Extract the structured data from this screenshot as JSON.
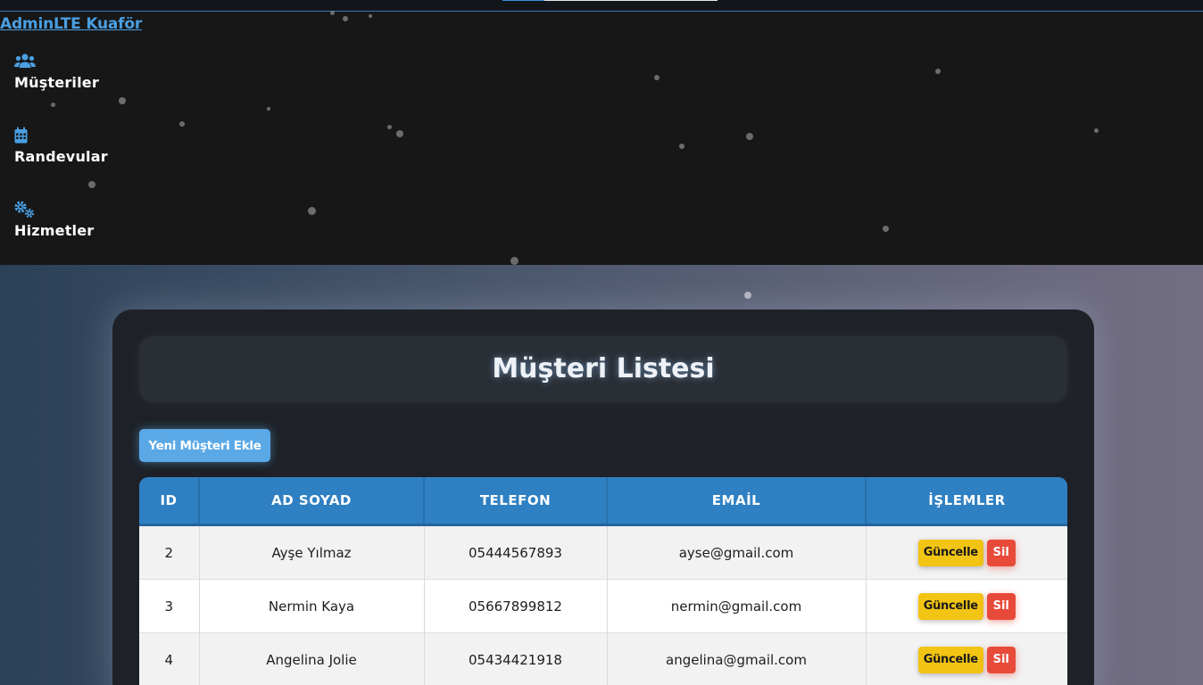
{
  "brand": {
    "label": "AdminLTE Kuaför"
  },
  "sidebar": {
    "items": [
      {
        "label": "Müşteriler",
        "icon": "users-icon"
      },
      {
        "label": "Randevular",
        "icon": "calendar-icon"
      },
      {
        "label": "Hizmetler",
        "icon": "cogs-icon"
      }
    ]
  },
  "main": {
    "title": "Müşteri Listesi",
    "add_button": "Yeni Müşteri Ekle",
    "table": {
      "columns": [
        "ID",
        "AD SOYAD",
        "TELEFON",
        "EMAİL",
        "İŞLEMLER"
      ],
      "rows": [
        {
          "id": "2",
          "name": "Ayşe Yılmaz",
          "phone": "05444567893",
          "email": "ayse@gmail.com"
        },
        {
          "id": "3",
          "name": "Nermin Kaya",
          "phone": "05667899812",
          "email": "nermin@gmail.com"
        },
        {
          "id": "4",
          "name": "Angelina Jolie",
          "phone": "05434421918",
          "email": "angelina@gmail.com"
        }
      ],
      "update_label": "Güncelle",
      "delete_label": "Sil"
    }
  },
  "colors": {
    "accent": "#4a9fe2",
    "table_header": "#2f80c2",
    "update": "#f2c413",
    "delete": "#e84a3a"
  }
}
